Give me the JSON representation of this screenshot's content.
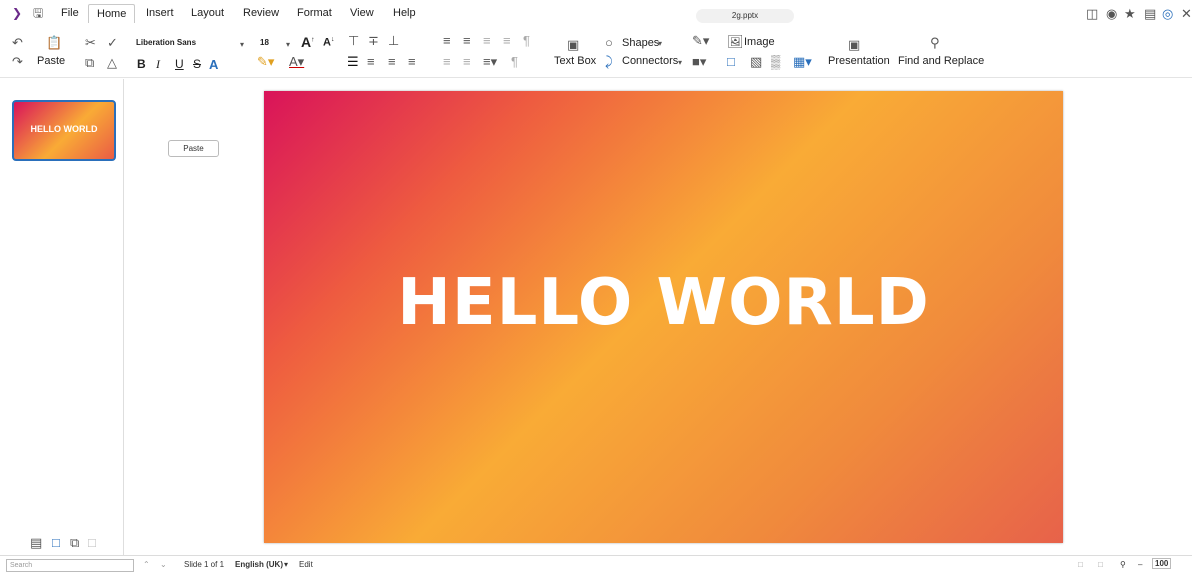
{
  "menubar": {
    "items": [
      "File",
      "Home",
      "Insert",
      "Layout",
      "Review",
      "Format",
      "View",
      "Help"
    ],
    "active": "Home",
    "document_title": "2g.pptx"
  },
  "toolbar": {
    "paste_label": "Paste",
    "font_name": "Liberation Sans",
    "font_size": "18",
    "bold": "B",
    "italic": "I",
    "underline": "U",
    "strike": "S",
    "shadow": "A",
    "text_box_label": "Text Box",
    "shapes_label": "Shapes",
    "connectors_label": "Connectors",
    "image_label": "Image",
    "presentation_label": "Presentation",
    "find_replace_label": "Find and Replace"
  },
  "sidebar": {
    "slides": [
      {
        "title": "HELLO WORLD"
      }
    ]
  },
  "popup": {
    "paste_label": "Paste"
  },
  "slide": {
    "title": "HELLO WORLD"
  },
  "statusbar": {
    "search_placeholder": "Search",
    "slide_info": "Slide 1 of 1",
    "language": "English (UK)",
    "mode": "Edit",
    "zoom": "100"
  },
  "colors": {
    "accent": "#2a6fbb",
    "gradient_start": "#d9135a",
    "gradient_mid": "#f9ab36",
    "gradient_end": "#ea5c44"
  }
}
